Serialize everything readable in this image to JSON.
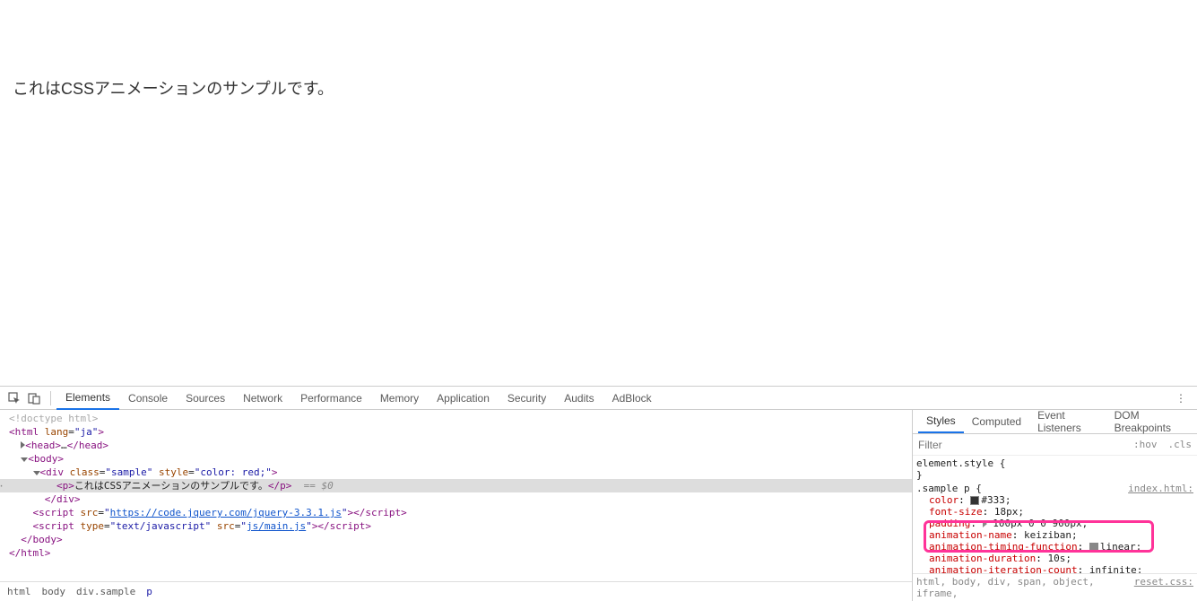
{
  "viewport": {
    "text": "これはCSSアニメーションのサンプルです。"
  },
  "toolbar": {
    "tabs": [
      "Elements",
      "Console",
      "Sources",
      "Network",
      "Performance",
      "Memory",
      "Application",
      "Security",
      "Audits",
      "AdBlock"
    ],
    "active": 0
  },
  "dom": {
    "doctype": "<!doctype html>",
    "html_open": "<html lang=\"ja\">",
    "head": "<head>…</head>",
    "body_open": "<body>",
    "div_open_class": "sample",
    "div_open_style": "color: red;",
    "p_text": "これはCSSアニメーションのサンプルです。",
    "eq0": "== $0",
    "div_close": "</div>",
    "script1_src": "https://code.jquery.com/jquery-3.3.1.js",
    "script2_type": "text/javascript",
    "script2_src": "js/main.js",
    "body_close": "</body>",
    "html_close": "</html>"
  },
  "breadcrumbs": [
    "html",
    "body",
    "div.sample",
    "p"
  ],
  "styles": {
    "tabs": [
      "Styles",
      "Computed",
      "Event Listeners",
      "DOM Breakpoints"
    ],
    "filter_placeholder": "Filter",
    "hov": ":hov",
    "cls": ".cls",
    "element_style": "element.style {",
    "rule_selector": ".sample p {",
    "source": "index.html:",
    "props": {
      "color_name": "color",
      "color_value": "#333;",
      "font_size_name": "font-size",
      "font_size_value": "18px;",
      "padding_name": "padding",
      "padding_value": "100px 0 0 900px;",
      "anim_name_name": "animation-name",
      "anim_name_value": "keiziban;",
      "anim_tf_name": "animation-timing-function",
      "anim_tf_value": "linear;",
      "anim_dur_name": "animation-duration",
      "anim_dur_value": "10s;",
      "anim_iter_name": "animation-iteration-count",
      "anim_iter_value": "infinite;"
    },
    "inherited_selector": "html, body, div, span, object, iframe,",
    "inherited_source": "reset.css:"
  }
}
